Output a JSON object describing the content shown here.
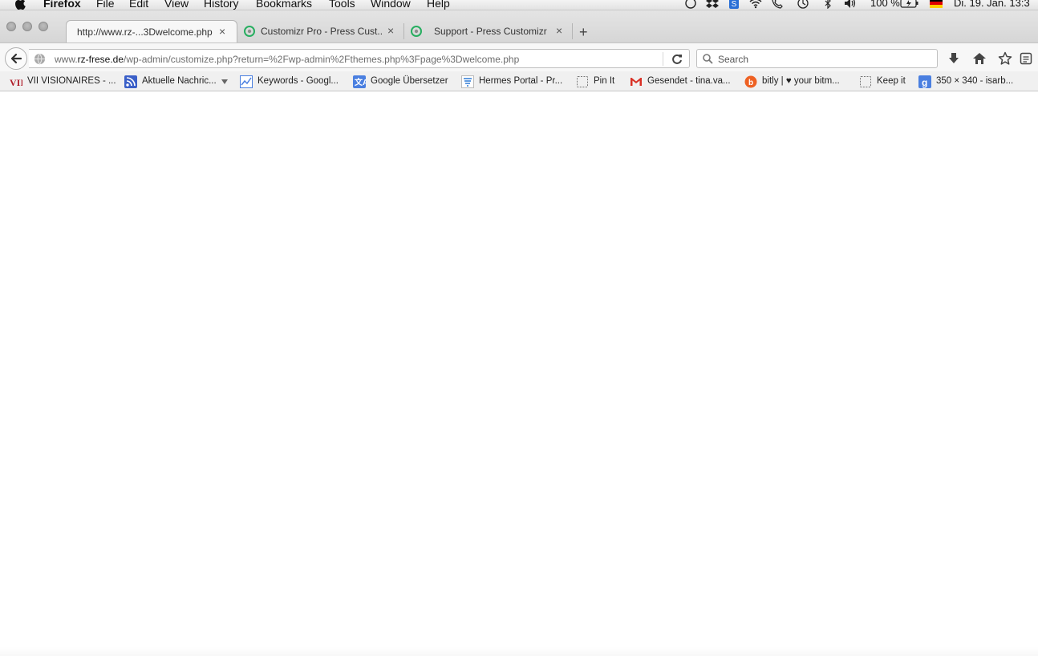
{
  "menubar": {
    "app_name": "Firefox",
    "items": [
      "File",
      "Edit",
      "View",
      "History",
      "Bookmarks",
      "Tools",
      "Window",
      "Help"
    ],
    "battery": "100 %",
    "datetime": "Di. 19. Jan. 13:3"
  },
  "tabs": [
    {
      "title": "http://www.rz-...3Dwelcome.php",
      "active": true
    },
    {
      "title": "Customizr Pro - Press Cust...",
      "active": false
    },
    {
      "title": "Support - Press Customizr",
      "active": false
    }
  ],
  "close_glyph": "×",
  "new_tab_glyph": "+",
  "urlbar": {
    "prefix": "www.",
    "domain": "rz-frese.de",
    "path": "/wp-admin/customize.php?return=%2Fwp-admin%2Fthemes.php%3Fpage%3Dwelcome.php"
  },
  "search": {
    "placeholder": "Search"
  },
  "bookmarks": [
    {
      "label": "VII VISIONAIRES - ...",
      "icon": "vii-favicon"
    },
    {
      "label": "Aktuelle Nachric...",
      "icon": "rss-feed-icon"
    },
    {
      "label": "Keywords - Googl...",
      "icon": "chart-favicon"
    },
    {
      "label": "Google Übersetzer",
      "icon": "translate-favicon"
    },
    {
      "label": "Hermes Portal - Pr...",
      "icon": "hermes-favicon"
    },
    {
      "label": "Pin It",
      "icon": "blank-page-icon"
    },
    {
      "label": "Gesendet - tina.va...",
      "icon": "gmail-favicon"
    },
    {
      "label": "bitly | ♥ your bitm...",
      "icon": "bitly-favicon"
    },
    {
      "label": "Keep it",
      "icon": "blank-page-icon"
    },
    {
      "label": "350 × 340 - isarb...",
      "icon": "google-image-favicon"
    }
  ],
  "colors": {
    "chrome": "#d6d6d6",
    "toolbar": "#f7f7f7",
    "bitly": "#ee6123",
    "gmail": "#d93025",
    "google_blue": "#4a7fe0",
    "vii_red": "#b01e2a",
    "customizr_green": "#27ae60"
  }
}
